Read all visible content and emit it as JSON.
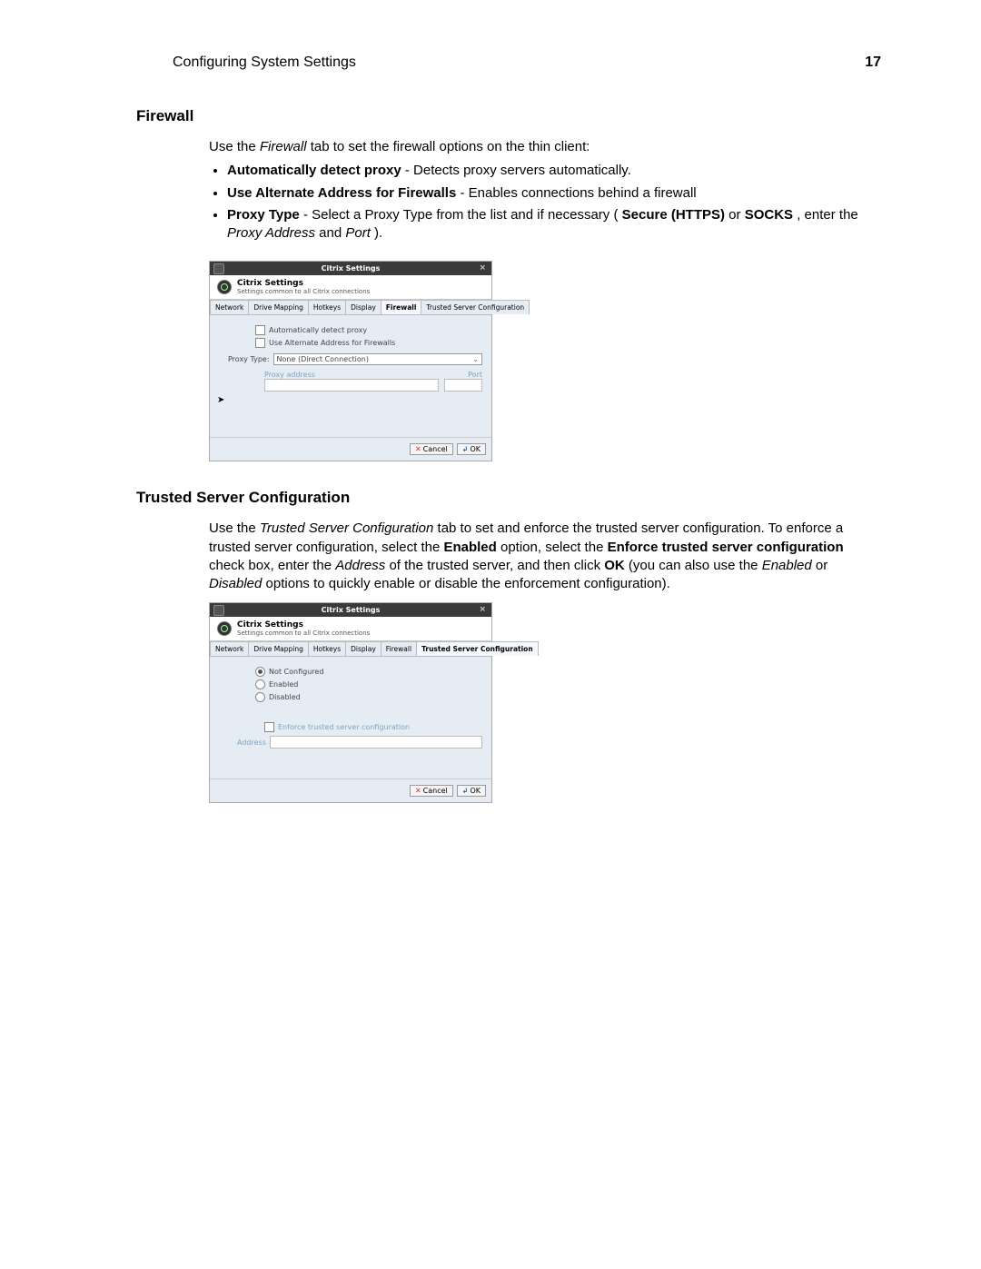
{
  "header": {
    "running_title": "Configuring System Settings",
    "page_number": "17"
  },
  "section1": {
    "heading": "Firewall",
    "intro_pre": "Use the ",
    "intro_em": "Firewall",
    "intro_post": " tab to set the firewall options on the thin client:",
    "bullet1_b": "Automatically detect proxy",
    "bullet1_rest": " - Detects proxy servers automatically.",
    "bullet2_b": "Use Alternate Address for Firewalls",
    "bullet2_rest": " - Enables connections behind a firewall",
    "bullet3_b1": "Proxy Type",
    "bullet3_mid1": " - Select a Proxy Type from the list and if necessary (",
    "bullet3_b2": "Secure (HTTPS)",
    "bullet3_mid2": " or ",
    "bullet3_b3": "SOCKS",
    "bullet3_mid3": ", enter the ",
    "bullet3_em1": "Proxy Address",
    "bullet3_mid4": " and ",
    "bullet3_em2": "Port",
    "bullet3_end": ")."
  },
  "dialog": {
    "title": "Citrix Settings",
    "header_title": "Citrix Settings",
    "header_sub": "Settings common to all Citrix connections",
    "tabs": [
      "Network",
      "Drive Mapping",
      "Hotkeys",
      "Display",
      "Firewall",
      "Trusted Server Configuration"
    ],
    "cb_auto": "Automatically detect proxy",
    "cb_alt": "Use Alternate Address for Firewalls",
    "proxy_type_label": "Proxy Type:",
    "proxy_type_value": "None (Direct Connection)",
    "proxy_address_label": "Proxy address",
    "port_label": "Port",
    "cancel": "Cancel",
    "ok": "OK"
  },
  "section2": {
    "heading": "Trusted Server Configuration",
    "p_pre": "Use the ",
    "p_em1": "Trusted Server Configuration",
    "p_mid1": " tab to set and enforce the trusted server configuration. To enforce a trusted server configuration, select the ",
    "p_b1": "Enabled",
    "p_mid2": " option, select the ",
    "p_b2": "Enforce trusted server configuration",
    "p_mid3": " check box, enter the ",
    "p_em2": "Address",
    "p_mid4": " of the trusted server, and then click ",
    "p_b3": "OK",
    "p_mid5": " (you can also use the ",
    "p_em3": "Enabled",
    "p_mid6": " or ",
    "p_em4": "Disabled",
    "p_mid7": " options to quickly enable or disable the enforcement configuration)."
  },
  "dialog2": {
    "active_tab": "Trusted Server Configuration",
    "r_notconf": "Not Configured",
    "r_enabled": "Enabled",
    "r_disabled": "Disabled",
    "enforce": "Enforce trusted server configuration",
    "address": "Address"
  }
}
